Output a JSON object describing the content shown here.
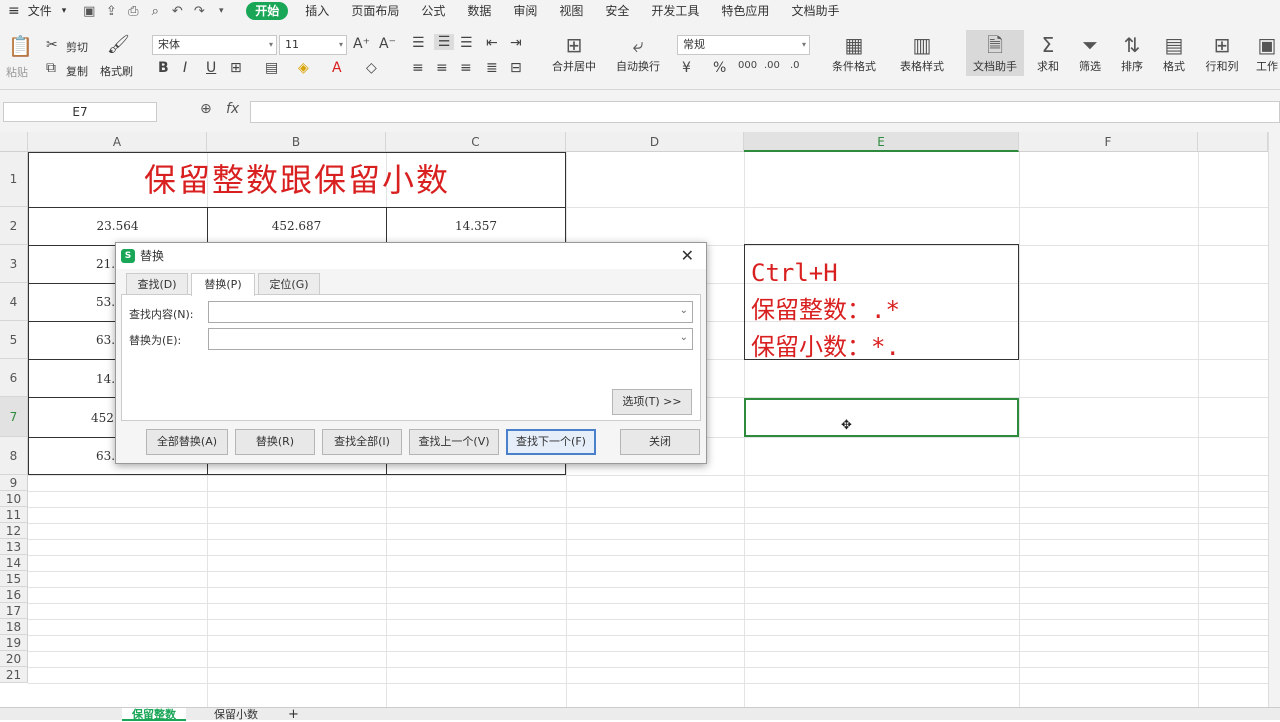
{
  "menubar": {
    "hamburger": "≡",
    "file": "文件",
    "tabs": [
      "开始",
      "插入",
      "页面布局",
      "公式",
      "数据",
      "审阅",
      "视图",
      "安全",
      "开发工具",
      "特色应用",
      "文档助手"
    ],
    "active_tab": "开始"
  },
  "ribbon": {
    "paste": "粘贴",
    "cut": "剪切",
    "copy": "复制",
    "format_painter": "格式刷",
    "font_name": "宋体",
    "font_size": "11",
    "bold": "B",
    "italic": "I",
    "underline": "U",
    "merge_center": "合并居中",
    "auto_wrap": "自动换行",
    "number_format": "常规",
    "conditional_format": "条件格式",
    "table_style": "表格样式",
    "doc_assistant": "文档助手",
    "sum": "求和",
    "filter": "筛选",
    "sort": "排序",
    "format": "格式",
    "row_col": "行和列",
    "worksheet": "工作"
  },
  "formula": {
    "cell_ref": "E7",
    "fx": "fx",
    "value": ""
  },
  "columns": [
    "A",
    "B",
    "C",
    "D",
    "E",
    "F"
  ],
  "rows": [
    "1",
    "2",
    "3",
    "4",
    "5",
    "6",
    "7",
    "8",
    "9",
    "10",
    "11",
    "12",
    "13",
    "14",
    "15",
    "16",
    "17",
    "18",
    "19",
    "20",
    "21"
  ],
  "sheet": {
    "title": "保留整数跟保留小数",
    "row2": [
      "23.564",
      "452.687",
      "14.357"
    ],
    "colA_partial": [
      "21.",
      "53.",
      "63.",
      "14.",
      "452",
      "63."
    ]
  },
  "note": {
    "line1": "Ctrl+H",
    "line2": "保留整数：.*",
    "line3": "保留小数：*."
  },
  "dialog": {
    "title": "替换",
    "tabs": [
      "查找(D)",
      "替换(P)",
      "定位(G)"
    ],
    "active_tab": "替换(P)",
    "find_label": "查找内容(N):",
    "find_value": "",
    "replace_label": "替换为(E):",
    "replace_value": "",
    "options": "选项(T) >>",
    "buttons": [
      "全部替换(A)",
      "替换(R)",
      "查找全部(I)",
      "查找上一个(V)",
      "查找下一个(F)",
      "关闭"
    ]
  },
  "sheet_tabs": [
    "保留整数",
    "保留小数"
  ],
  "add_sheet": "+"
}
